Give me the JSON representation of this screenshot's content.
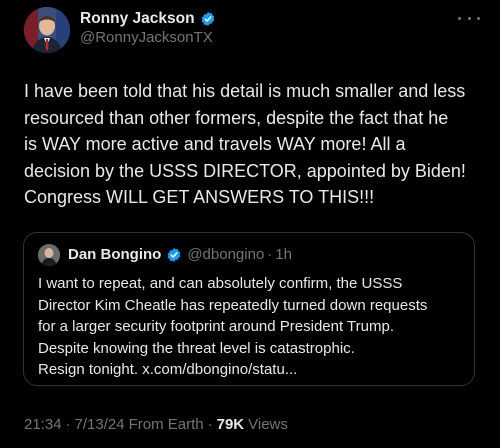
{
  "tweet": {
    "author_name": "Ronny Jackson",
    "author_handle": "@RonnyJacksonTX",
    "text": "I have been told that his detail is much smaller and less\nresourced than other formers, despite the fact that he\nis WAY more active and travels WAY more! All a\ndecision by the USSS DIRECTOR, appointed by Biden!\nCongress WILL GET ANSWERS TO THIS!!!",
    "verified_color": "#1d9bf0"
  },
  "quote": {
    "author_name": "Dan Bongino",
    "author_handle": "@dbongino",
    "dot": "·",
    "time": "1h",
    "text": "I want to repeat, and can absolutely confirm, the USSS\nDirector Kim Cheatle has repeatedly turned down requests\nfor a larger security footprint around President Trump.\nDespite knowing the threat level is catastrophic.\nResign tonight. x.com/dbongino/statu..."
  },
  "footer": {
    "time": "21:34",
    "date": "7/13/24",
    "source": "From Earth",
    "views_count": "79K",
    "views_label": "Views",
    "separator": "·"
  },
  "icons": {
    "verified": "verified-badge-icon",
    "more": "more-options-icon"
  }
}
